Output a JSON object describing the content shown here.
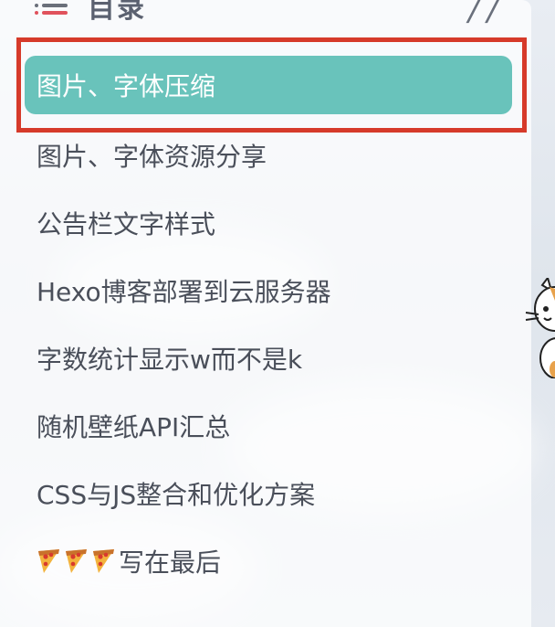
{
  "toc": {
    "title": "目录",
    "items": [
      {
        "label": "图片、字体压缩",
        "active": true
      },
      {
        "label": "图片、字体资源分享"
      },
      {
        "label": "公告栏文字样式"
      },
      {
        "label": "Hexo博客部署到云服务器"
      },
      {
        "label": "字数统计显示w而不是k"
      },
      {
        "label": "随机壁纸API汇总"
      },
      {
        "label": "CSS与JS整合和优化方案"
      },
      {
        "label": "写在最后",
        "prefix_icons": [
          "pizza-icon",
          "pizza-icon",
          "pizza-icon"
        ]
      }
    ]
  },
  "colors": {
    "active_bg": "#69c3bb",
    "highlight_border": "#d63a2a",
    "text": "#4a4f5a"
  },
  "icons": [
    "list-icon",
    "pizza-icon",
    "cat-mascot"
  ]
}
